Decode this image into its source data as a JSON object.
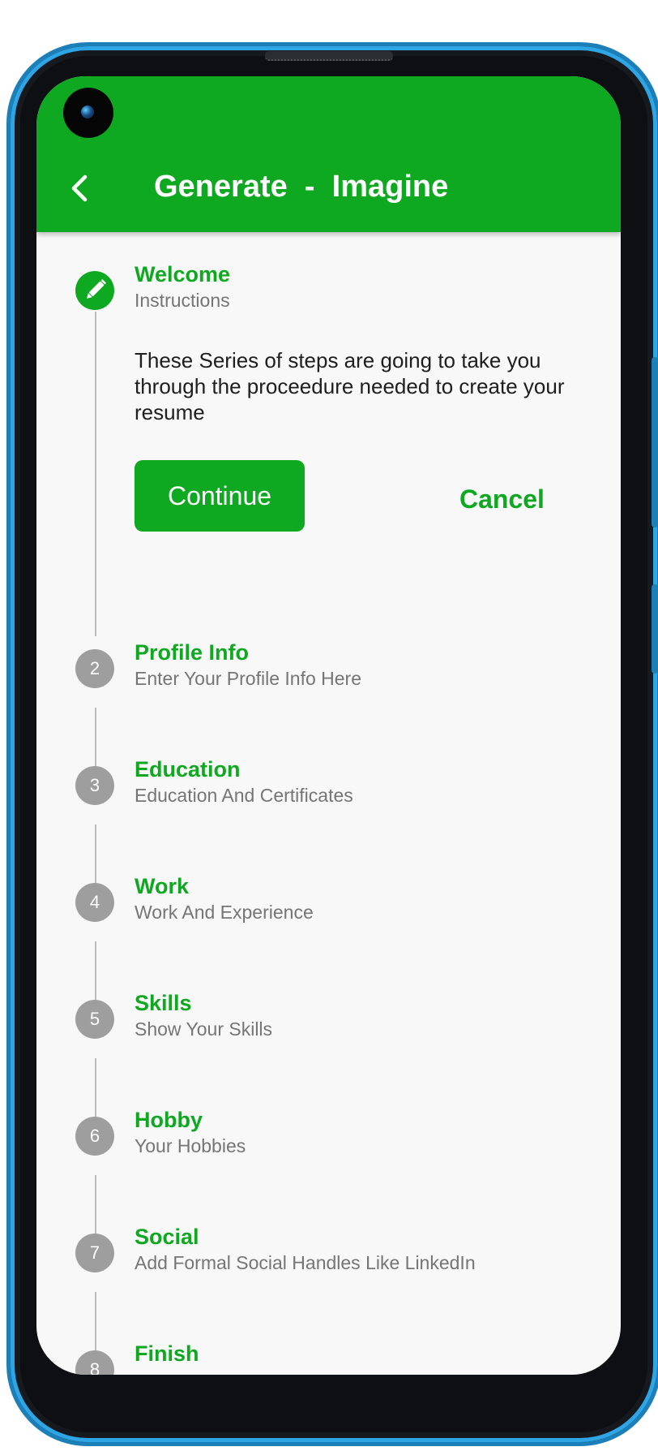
{
  "appbar": {
    "title": "Generate  -  Imagine"
  },
  "stepper": {
    "steps": [
      {
        "number": "",
        "title": "Welcome",
        "subtitle": "Instructions"
      },
      {
        "number": "2",
        "title": "Profile Info",
        "subtitle": "Enter Your Profile Info Here"
      },
      {
        "number": "3",
        "title": "Education",
        "subtitle": "Education And Certificates"
      },
      {
        "number": "4",
        "title": "Work",
        "subtitle": "Work And Experience"
      },
      {
        "number": "5",
        "title": "Skills",
        "subtitle": "Show Your Skills"
      },
      {
        "number": "6",
        "title": "Hobby",
        "subtitle": "Your Hobbies"
      },
      {
        "number": "7",
        "title": "Social",
        "subtitle": "Add Formal Social Handles Like LinkedIn"
      },
      {
        "number": "8",
        "title": "Finish",
        "subtitle": ""
      }
    ],
    "active_content": "These Series of steps are going to take you through the proceedure needed to create your resume",
    "continue_label": "Continue",
    "cancel_label": "Cancel"
  },
  "colors": {
    "primary": "#0ea920",
    "inactive": "#9e9e9e",
    "background": "#f8f8f8",
    "frame": "#1c7fb8"
  },
  "icons": {
    "back": "arrow-back-icon",
    "active_step": "edit-pencil-icon",
    "camera": "front-camera"
  }
}
